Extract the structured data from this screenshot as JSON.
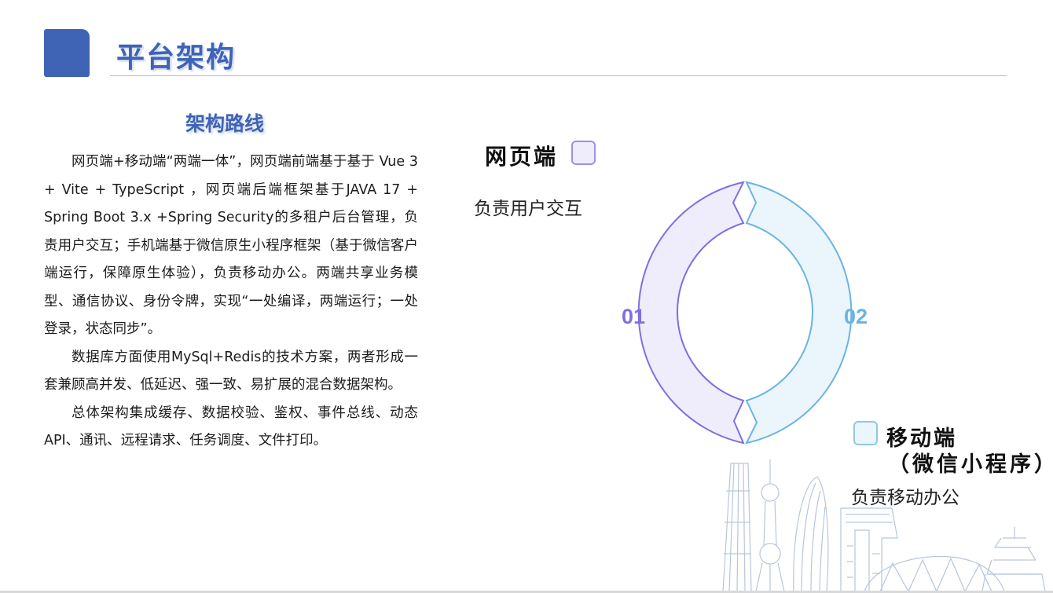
{
  "header": {
    "title": "平台架构"
  },
  "section": {
    "title": "架构路线",
    "paragraphs": [
      "网页端+移动端“两端一体”，网页端前端基于基于 Vue 3 + Vite + TypeScript ，网页端后端框架基于JAVA 17 + Spring Boot 3.x +Spring Security的多租户后台管理，负责用户交互；手机端基于微信原生小程序框架（基于微信客户端运行，保障原生体验），负责移动办公。两端共享业务模型、通信协议、身份令牌，实现“一处编译，两端运行；一处登录，状态同步”。",
      "数据库方面使用MySql+Redis的技术方案，两者形成一套兼顾高并发、低延迟、强一致、易扩展的混合数据架构。",
      "总体架构集成缓存、数据校验、鉴权、事件总线、动态API、通讯、远程请求、任务调度、文件打印。"
    ]
  },
  "diagram": {
    "web": {
      "label": "网页端",
      "description": "负责用户交互",
      "number": "01",
      "color": "#7e6fe0",
      "fill": "#efedfb"
    },
    "mobile": {
      "label": "移动端",
      "label_sub": "（微信小程序）",
      "description": "负责移动办公",
      "number": "02",
      "color": "#6ab4e2",
      "fill": "#eaf5fc"
    }
  }
}
